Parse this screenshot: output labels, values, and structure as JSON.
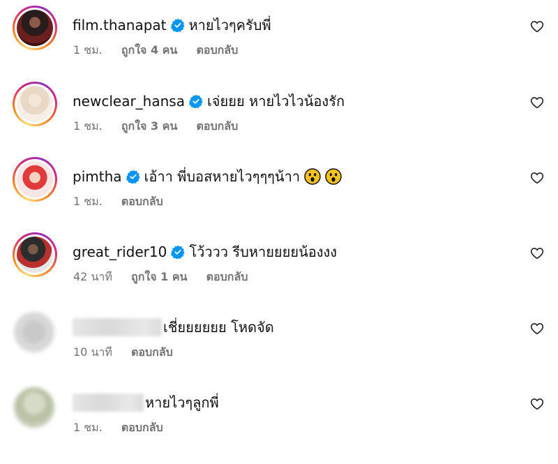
{
  "comments": [
    {
      "username": "film.thanapat",
      "verified": true,
      "text": "หายไวๆครับพี่",
      "time": "1 ชม.",
      "likes": "ถูกใจ 4 คน",
      "reply": "ตอบกลับ"
    },
    {
      "username": "newclear_hansa",
      "verified": true,
      "text": "เจ่ยยย หายไวไวน้องรัก",
      "time": "1 ชม.",
      "likes": "ถูกใจ 3 คน",
      "reply": "ตอบกลับ"
    },
    {
      "username": "pimtha",
      "verified": true,
      "text": "เอ้าา พี่บอสหายไวๆๆๆน้าา",
      "time": "1 ชม.",
      "reply": "ตอบกลับ",
      "emoji": [
        "astonished-face-icon",
        "astonished-face-icon"
      ]
    },
    {
      "username": "great_rider10",
      "verified": true,
      "text": "โว้ววว รีบหายยยยน้องงง",
      "time": "42 นาที",
      "likes": "ถูกใจ 1 คน",
      "reply": "ตอบกลับ"
    },
    {
      "username_hidden": true,
      "text": "เชี่ยยยยยย โหดจัด",
      "time": "10 นาที",
      "reply": "ตอบกลับ"
    },
    {
      "username_hidden": true,
      "text": "หายไวๆลูกพี่",
      "time": "1 ชม.",
      "reply": "ตอบกลับ"
    }
  ],
  "icons": {
    "verified": "verified-badge-icon",
    "like": "heart-outline-icon"
  },
  "colors": {
    "verified": "#0095f6",
    "meta_text": "#737373"
  }
}
